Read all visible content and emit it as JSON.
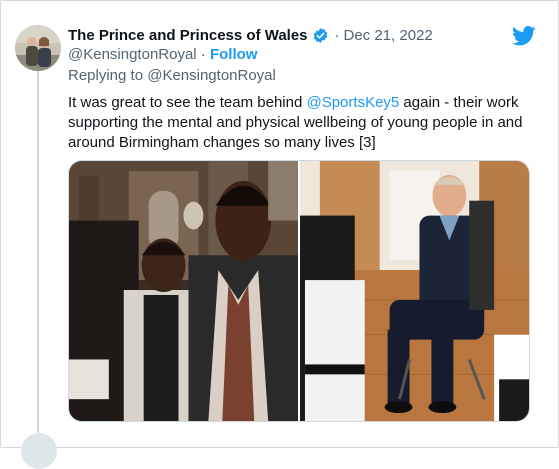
{
  "tweet": {
    "author_name": "The Prince and Princess of Wales",
    "separator": "·",
    "date": "Dec 21, 2022",
    "handle": "@KensingtonRoyal",
    "handle_separator": " · ",
    "follow_label": "Follow",
    "reply_prefix": "Replying to ",
    "reply_to": "@KensingtonRoyal",
    "text_before": "It was great to see the team behind ",
    "mention": "@SportsKey5",
    "text_after": " again - their work supporting the mental and physical wellbeing of young people in and around Birmingham changes so many lives [3]"
  },
  "icons": {
    "verified": "verified-badge-icon",
    "brand": "twitter-bird-icon"
  },
  "colors": {
    "accent": "#1d9bf0",
    "secondary_text": "#536471",
    "primary_text": "#0f1419",
    "border": "#cfd9de"
  }
}
